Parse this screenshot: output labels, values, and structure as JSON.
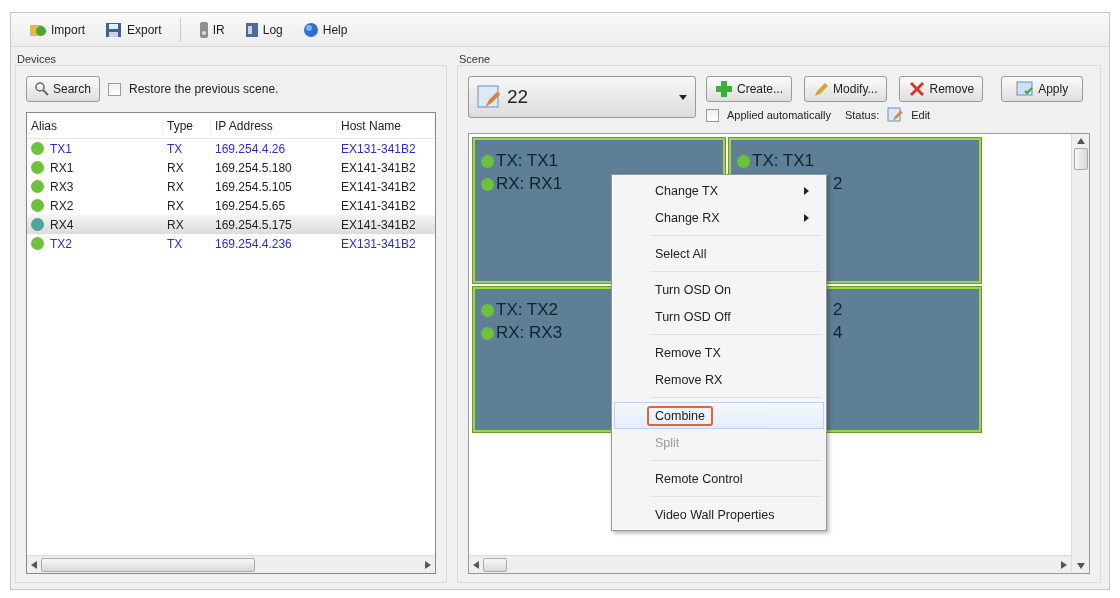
{
  "toolbar": [
    {
      "label": "Import"
    },
    {
      "label": "Export"
    },
    {
      "label": "IR"
    },
    {
      "label": "Log"
    },
    {
      "label": "Help"
    }
  ],
  "devices": {
    "title": "Devices",
    "search_button": "Search",
    "restore": {
      "label": "Restore the previous scene.",
      "checked": false
    },
    "columns": [
      "Alias",
      "Type",
      "IP Address",
      "Host Name"
    ],
    "rows": [
      {
        "alias": "TX1",
        "type": "TX",
        "ip": "169.254.4.26",
        "host": "EX131-341B2",
        "kind": "tx",
        "color": "#6cc23a",
        "selected": false
      },
      {
        "alias": "RX1",
        "type": "RX",
        "ip": "169.254.5.180",
        "host": "EX141-341B2",
        "kind": "rx",
        "color": "#6cc23a",
        "selected": false
      },
      {
        "alias": "RX3",
        "type": "RX",
        "ip": "169.254.5.105",
        "host": "EX141-341B2",
        "kind": "rx",
        "color": "#6cc23a",
        "selected": false
      },
      {
        "alias": "RX2",
        "type": "RX",
        "ip": "169.254.5.65",
        "host": "EX141-341B2",
        "kind": "rx",
        "color": "#6cc23a",
        "selected": false
      },
      {
        "alias": "RX4",
        "type": "RX",
        "ip": "169.254.5.175",
        "host": "EX141-341B2",
        "kind": "rx",
        "color": "#4aa59a",
        "selected": true
      },
      {
        "alias": "TX2",
        "type": "TX",
        "ip": "169.254.4.236",
        "host": "EX131-341B2",
        "kind": "tx",
        "color": "#6cc23a",
        "selected": false
      }
    ]
  },
  "scene": {
    "title": "Scene",
    "selector": "22",
    "buttons": [
      "Create...",
      "Modify...",
      "Remove",
      "Apply"
    ],
    "auto_apply": {
      "label": "Applied automatically",
      "checked": false
    },
    "status_label": "Status:",
    "status_value": "Edit",
    "tiles": [
      {
        "lines": [
          {
            "text": "TX: TX1",
            "kind": "full"
          },
          {
            "text": "RX: RX1",
            "kind": "full"
          }
        ]
      },
      {
        "lines": [
          {
            "text": "TX: TX1",
            "kind": "full"
          },
          {
            "text": "2",
            "kind": "partial"
          }
        ]
      },
      {
        "lines": [
          {
            "text": "TX: TX2",
            "kind": "full"
          },
          {
            "text": "RX: RX3",
            "kind": "full"
          }
        ]
      },
      {
        "lines": [
          {
            "text": "2",
            "kind": "partial"
          },
          {
            "text": "4",
            "kind": "partial"
          }
        ]
      }
    ]
  },
  "context_menu": {
    "sections": [
      {
        "items": [
          {
            "label": "Change TX",
            "submenu": true,
            "selected": false,
            "disabled": false
          },
          {
            "label": "Change RX",
            "submenu": true,
            "selected": false,
            "disabled": false
          }
        ]
      },
      {
        "items": [
          {
            "label": "Select All",
            "submenu": false,
            "selected": false,
            "disabled": false
          }
        ]
      },
      {
        "items": [
          {
            "label": "Turn OSD On",
            "submenu": false,
            "selected": false,
            "disabled": false
          },
          {
            "label": "Turn OSD Off",
            "submenu": false,
            "selected": false,
            "disabled": false
          }
        ]
      },
      {
        "items": [
          {
            "label": "Remove TX",
            "submenu": false,
            "selected": false,
            "disabled": false
          },
          {
            "label": "Remove RX",
            "submenu": false,
            "selected": false,
            "disabled": false
          }
        ]
      },
      {
        "items": [
          {
            "label": "Combine",
            "submenu": false,
            "selected": true,
            "disabled": false
          },
          {
            "label": "Split",
            "submenu": false,
            "selected": false,
            "disabled": true
          }
        ]
      },
      {
        "items": [
          {
            "label": "Remote Control",
            "submenu": false,
            "selected": false,
            "disabled": false
          }
        ]
      },
      {
        "items": [
          {
            "label": "Video Wall Properties",
            "submenu": false,
            "selected": false,
            "disabled": false
          }
        ]
      }
    ]
  }
}
